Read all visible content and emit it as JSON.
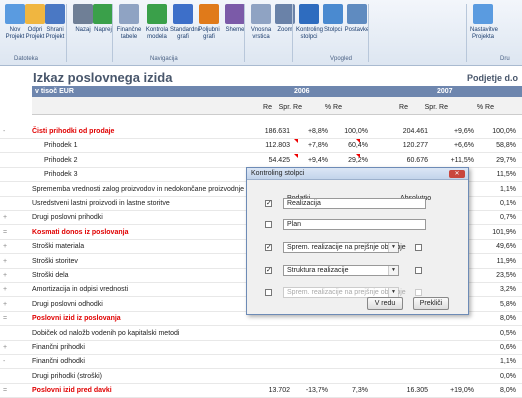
{
  "ribbon": {
    "buttons": [
      {
        "label": "Nov\nProjekt",
        "icon": "new-project-icon"
      },
      {
        "label": "Odpri\nProjekt",
        "icon": "open-project-icon"
      },
      {
        "label": "Shrani\nProjekt",
        "icon": "save-project-icon"
      },
      {
        "label": "Nazaj",
        "icon": "back-icon"
      },
      {
        "label": "Naprej",
        "icon": "forward-icon"
      },
      {
        "label": "Finančne\ntabele",
        "icon": "financial-tables-icon"
      },
      {
        "label": "Kontrola\nmodela",
        "icon": "checkmark-icon"
      },
      {
        "label": "Standardni\ngrafi",
        "icon": "bar-chart-icon"
      },
      {
        "label": "Poljubni\ngrafi",
        "icon": "custom-chart-icon"
      },
      {
        "label": "Sheme",
        "icon": "scheme-icon"
      },
      {
        "label": "Vnosna\nvrstica",
        "icon": "input-row-icon"
      },
      {
        "label": "Zoom",
        "icon": "zoom-icon"
      },
      {
        "label": "Kontroling\nstolpci",
        "icon": "column-control-icon"
      },
      {
        "label": "Stolpci",
        "icon": "columns-icon"
      },
      {
        "label": "Postavke",
        "icon": "items-icon"
      },
      {
        "label": "Nastavitve\nProjekta",
        "icon": "project-settings-icon"
      }
    ],
    "groups": [
      "Datoteka",
      "Navigacija",
      "Vpogled",
      "Dru"
    ]
  },
  "report": {
    "title": "Izkaz poslovnega izida",
    "title_right": "Podjetje d.o",
    "unit": "v tisoč EUR",
    "year1": "2006",
    "year2": "2007",
    "sub": [
      "Re",
      "Spr. Re",
      "% Re",
      "Re",
      "Spr. Re",
      "% Re"
    ]
  },
  "rows": [
    {
      "mk": "-",
      "label": "Čisti prihodki od prodaje",
      "red": true,
      "v": [
        "186.631",
        "+8,8%",
        "100,0%",
        "204.461",
        "+9,6%",
        "100,0%"
      ]
    },
    {
      "mk": "",
      "label": "Prihodek 1",
      "indent": true,
      "v": [
        "112.803",
        "+7,8%",
        "60,4%",
        "120.277",
        "+6,6%",
        "58,8%"
      ]
    },
    {
      "mk": "",
      "label": "Prihodek 2",
      "indent": true,
      "v": [
        "54.425",
        "+9,4%",
        "29,2%",
        "60.676",
        "+11,5%",
        "29,7%"
      ]
    },
    {
      "mk": "",
      "label": "Prihodek 3",
      "indent": true,
      "v": [
        "",
        "",
        "",
        "",
        "",
        "11,5%"
      ]
    },
    {
      "mk": "",
      "label": "Sprememba vrednosti zalog proizvodov in nedokončane proizvodnje",
      "v": [
        "",
        "",
        "",
        "",
        "",
        "1,1%"
      ]
    },
    {
      "mk": "",
      "label": "Usredstveni lastni proizvodi in lastne storitve",
      "v": [
        "",
        "",
        "",
        "",
        "",
        "0,1%"
      ]
    },
    {
      "mk": "+",
      "label": "Drugi poslovni prihodki",
      "v": [
        "",
        "",
        "",
        "",
        "",
        "0,7%"
      ]
    },
    {
      "mk": "=",
      "label": "Kosmati donos iz poslovanja",
      "red": true,
      "v": [
        "",
        "",
        "",
        "",
        "",
        "101,9%"
      ]
    },
    {
      "mk": "+",
      "label": "Stroški materiala",
      "v": [
        "",
        "",
        "",
        "",
        "",
        "49,6%"
      ]
    },
    {
      "mk": "+",
      "label": "Stroški storitev",
      "v": [
        "",
        "",
        "",
        "",
        "",
        "11,9%"
      ]
    },
    {
      "mk": "+",
      "label": "Stroški dela",
      "v": [
        "",
        "",
        "",
        "",
        "",
        "23,5%"
      ]
    },
    {
      "mk": "+",
      "label": "Amortizacija in odpisi vrednosti",
      "v": [
        "",
        "",
        "",
        "",
        "",
        "3,2%"
      ]
    },
    {
      "mk": "+",
      "label": "Drugi poslovni odhodki",
      "v": [
        "",
        "",
        "",
        "",
        "",
        "5,8%"
      ]
    },
    {
      "mk": "=",
      "label": "Poslovni izid iz poslovanja",
      "red": true,
      "v": [
        "",
        "",
        "",
        "",
        "",
        "8,0%"
      ]
    },
    {
      "mk": "",
      "label": "Dobiček od naložb vodenih po kapitalski metodi",
      "v": [
        "",
        "",
        "",
        "",
        "",
        "0,5%"
      ]
    },
    {
      "mk": "+",
      "label": "Finančni prihodki",
      "v": [
        "",
        "",
        "",
        "",
        "",
        "0,6%"
      ]
    },
    {
      "mk": "-",
      "label": "Finančni odhodki",
      "v": [
        "",
        "",
        "",
        "",
        "",
        "1,1%"
      ]
    },
    {
      "mk": "",
      "label": "Drugi prihodki (stroški)",
      "v": [
        "",
        "",
        "",
        "",
        "",
        "0,0%"
      ]
    },
    {
      "mk": "=",
      "label": "Poslovni izid pred davki",
      "red": true,
      "v": [
        "13.702",
        "-13,7%",
        "7,3%",
        "16.305",
        "+19,0%",
        "8,0%"
      ]
    }
  ],
  "dialog": {
    "title": "Kontroling stolpci",
    "col_data": "Podatki",
    "col_abs": "Absolutno",
    "items": [
      {
        "checked": true,
        "text": "Realizacija",
        "dropdown": false,
        "abs": false,
        "disabled": false
      },
      {
        "checked": false,
        "text": "Plan",
        "dropdown": false,
        "abs": false,
        "disabled": false
      },
      {
        "checked": true,
        "text": "Sprem. realizacije na prejšnje obdobje",
        "dropdown": true,
        "abs": false,
        "disabled": false
      },
      {
        "checked": true,
        "text": "Struktura realizacije",
        "dropdown": true,
        "abs": false,
        "disabled": false
      },
      {
        "checked": false,
        "text": "Sprem. realizacije na prejšnje obdobje",
        "dropdown": true,
        "abs": false,
        "disabled": true
      }
    ],
    "ok": "V redu",
    "cancel": "Prekliči"
  }
}
